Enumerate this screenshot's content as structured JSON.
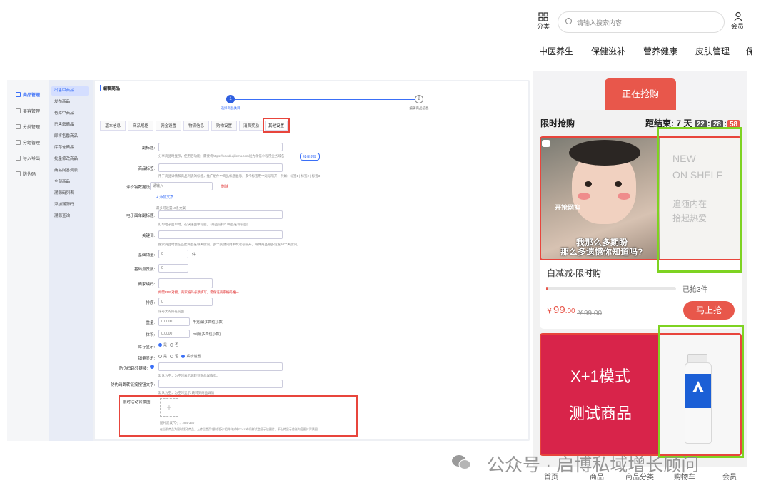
{
  "admin": {
    "side_menu": [
      {
        "label": "商品管理",
        "active": true
      },
      {
        "label": "美容管理",
        "active": false
      },
      {
        "label": "分类管理",
        "active": false
      },
      {
        "label": "分组管理",
        "active": false
      },
      {
        "label": "导入导出",
        "active": false
      },
      {
        "label": "防伪码",
        "active": false
      }
    ],
    "sub_menu": [
      {
        "label": "出售中商品",
        "active": true
      },
      {
        "label": "发布商品",
        "active": false
      },
      {
        "label": "仓库中商品",
        "active": false
      },
      {
        "label": "已售罄商品",
        "active": false
      },
      {
        "label": "即将售罄商品",
        "active": false
      },
      {
        "label": "库存仓商品",
        "active": false
      },
      {
        "label": "批量修改商品",
        "active": false
      },
      {
        "label": "商品问答列表",
        "active": false
      },
      {
        "label": "全部商品",
        "active": false
      },
      {
        "label": "溯源码列表",
        "active": false
      },
      {
        "label": "添加溯源码",
        "active": false
      },
      {
        "label": "溯源查询",
        "active": false
      }
    ],
    "page_title": "编辑商品",
    "steps": [
      {
        "num": "1",
        "label": "选择商品类目"
      },
      {
        "num": "2",
        "label": "编辑商品信息"
      }
    ],
    "tabs": [
      "基本信息",
      "商品规格",
      "佣金设置",
      "物流信息",
      "购物设置",
      "消费奖励",
      "其他设置"
    ],
    "form": {
      "subtitle_label": "副标题:",
      "subtitle_hint": "分享商品时显示，使用后功能，需要将https://xcx.dr.qikcms.com设为微信小程序业务域名",
      "subtitle_btn": "操作步骤",
      "tag_label": "商品标签:",
      "tag_hint": "用于商品详情和商品列表的标签，推广组件中商品标题显示，多个标签用\"|\"逗号隔开，例如：标签1 | 标签2 | 标签3",
      "review_label": "评价钩数据设置:",
      "review_placeholder": "请输入",
      "review_delete": "删除",
      "add_copy": "+ 添加文案",
      "add_copy_hint": "最多可设置10条文案",
      "efi_label": "电子面单副标题:",
      "efi_hint": "打印电子面单时，在快递面单标题，（商品前打印商品名称前面）",
      "keyword_label": "关键词:",
      "keyword_hint": "搜索商品时会在匹配商品名称关键词，多个关键词用中文逗号隔开，每件商品最多设置10个关键词。",
      "base_sales_label": "基础销量:",
      "base_sales_value": "0",
      "base_sales_unit": "件",
      "base_likes_label": "基础点赞数:",
      "base_likes_value": "0",
      "code_label": "商家编码:",
      "code_hint": "如需ERP对接，商家编码必须填写，需保证商家编码唯一",
      "sort_label": "排序:",
      "sort_value": "0",
      "sort_hint": "序号大的排在前面",
      "weight_label": "重量:",
      "weight_value": "0.0000",
      "weight_unit": "千克(最多四位小数)",
      "volume_label": "体积:",
      "volume_value": "0.0000",
      "volume_unit": "m³(最多四位小数)",
      "stock_show_label": "库存显示:",
      "sales_show_label": "销量显示:",
      "opt_yes": "是",
      "opt_no": "否",
      "opt_system": "系统设置",
      "anti_link_label": "防伪码跳转链接:",
      "anti_link_hint": "默认为空，为空时表示跳转到商品详情页。",
      "anti_btn_label": "防伪码跳转链接按钮文字:",
      "anti_btn_hint": "默认为空，为空时显示\"跳转到商品详情\"",
      "promo_label": "限时活动背景图:",
      "promo_size_hint": "图片建议尺寸：284*330",
      "promo_hint": "在当前商品为限时活动商品，上传后首页\"限时活动\"组件样式中\"X+1\"布局样式会显示该图片，不上传显示首张内容图片背景图"
    }
  },
  "mobile": {
    "top": {
      "category_label": "分类",
      "search_placeholder": "请输入搜索内容",
      "member_label": "会员"
    },
    "categories": [
      "中医养生",
      "保健滋补",
      "营养健康",
      "皮肤管理"
    ],
    "flash_tab": "正在抢购",
    "flash_title": "限时抢购",
    "countdown_prefix": "距结束: 7",
    "countdown_day": "天",
    "countdown_h": "22",
    "countdown_m": "28",
    "countdown_s": "58",
    "product1": {
      "banner_top": "开抢网抑",
      "banner_line1": "我那么多期盼",
      "banner_line2": "那么多遗憾你知道吗?",
      "side_line1": "NEW",
      "side_line2": "ON SHELF",
      "side_line3": "追随内在",
      "side_line4": "拾起热爱",
      "name": "白减减-限时购",
      "sold": "已抢3件",
      "sold_fraction": 0.01,
      "price_symbol": "￥",
      "price_int": "99",
      "price_dec": ".00",
      "price_orig": "￥99.00",
      "buy_btn": "马上抢"
    },
    "product2": {
      "line1": "X+1模式",
      "line2": "测试商品"
    },
    "bottom_nav": [
      "首页",
      "商品",
      "商品分类",
      "购物车",
      "会员"
    ],
    "watermark": "公众号 · 启博私域增长顾问"
  },
  "colors": {
    "accent_blue": "#3a6ff7",
    "flash_red": "#e8574b",
    "highlight_red": "#e8453c",
    "highlight_green": "#7ed321",
    "promo_crimson": "#d8244a"
  }
}
